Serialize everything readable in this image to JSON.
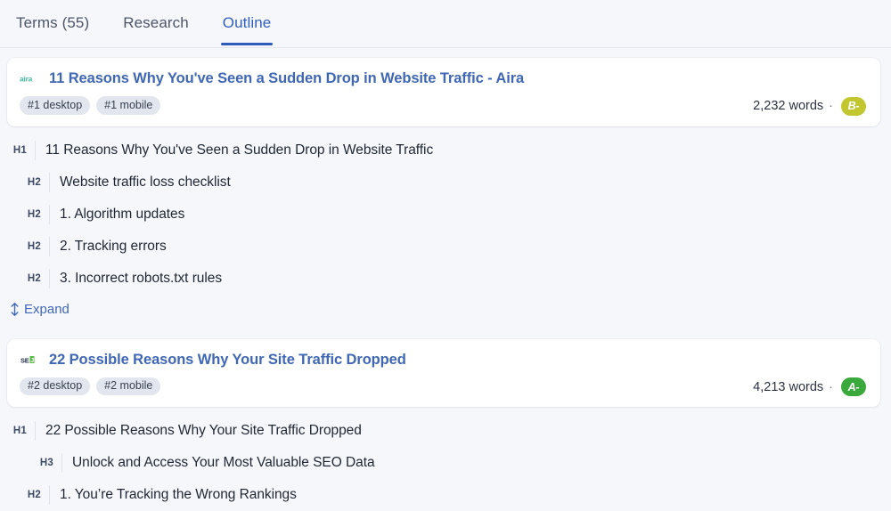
{
  "tabs": [
    {
      "label": "Terms (55)",
      "active": false,
      "name": "tab-terms"
    },
    {
      "label": "Research",
      "active": false,
      "name": "tab-research"
    },
    {
      "label": "Outline",
      "active": true,
      "name": "tab-outline"
    }
  ],
  "colors": {
    "page_background": "#f6f7fb",
    "card_background": "#ffffff",
    "accent_blue": "#2e5cb8",
    "link_blue": "#3f67b4",
    "grade_b_minus": "#c2c62f",
    "grade_a_minus": "#38a93a",
    "pill_background": "#e2e6ee"
  },
  "results": [
    {
      "favicon": {
        "name": "aira-favicon",
        "text": "aira",
        "color": "#4cb6a2"
      },
      "title": "11 Reasons Why You've Seen a Sudden Drop in Website Traffic - Aira",
      "pills": [
        "#1 desktop",
        "#1 mobile"
      ],
      "words": "2,232 words",
      "separator": "·",
      "grade": {
        "label": "B-",
        "color": "#c2c62f"
      },
      "outline": [
        {
          "level": "H1",
          "text": "11 Reasons Why You've Seen a Sudden Drop in Website Traffic"
        },
        {
          "level": "H2",
          "text": "Website traffic loss checklist"
        },
        {
          "level": "H2",
          "text": "1. Algorithm updates"
        },
        {
          "level": "H2",
          "text": "2. Tracking errors"
        },
        {
          "level": "H2",
          "text": "3. Incorrect robots.txt rules"
        }
      ],
      "expand": {
        "label": "Expand",
        "icon": "↕"
      }
    },
    {
      "favicon": {
        "name": "sej-favicon",
        "text": "SEJ",
        "color": "#1b2a4a"
      },
      "title": "22 Possible Reasons Why Your Site Traffic Dropped",
      "pills": [
        "#2 desktop",
        "#2 mobile"
      ],
      "words": "4,213 words",
      "separator": "·",
      "grade": {
        "label": "A-",
        "color": "#38a93a"
      },
      "outline": [
        {
          "level": "H1",
          "text": "22 Possible Reasons Why Your Site Traffic Dropped"
        },
        {
          "level": "H3",
          "text": "Unlock and Access Your Most Valuable SEO Data"
        },
        {
          "level": "H2",
          "text": "1. You’re Tracking the Wrong Rankings"
        }
      ],
      "expand": null
    }
  ]
}
